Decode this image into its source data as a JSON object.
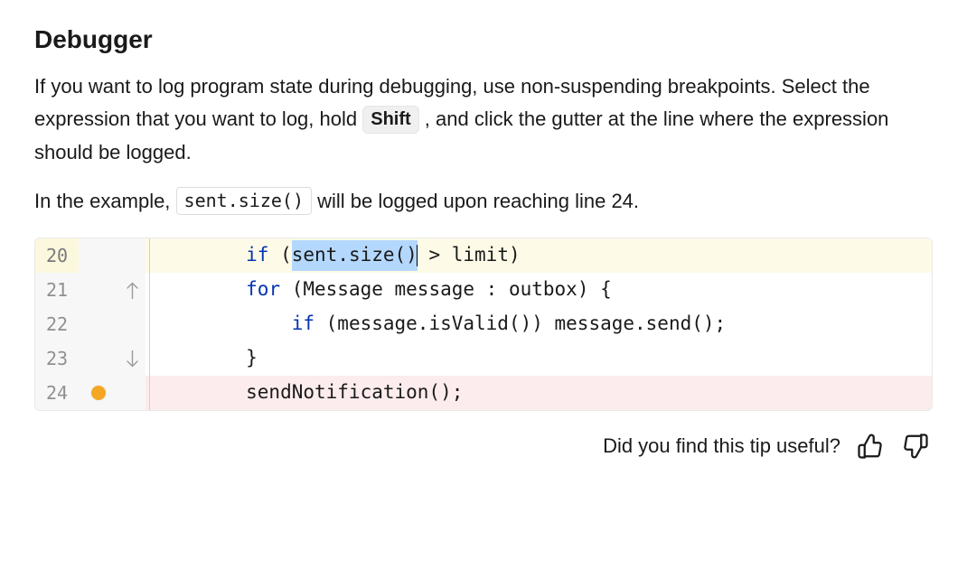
{
  "title": "Debugger",
  "para1": {
    "t0": "If you want to log program state during debugging, use non-suspending breakpoints. Select the expression that you want to log, hold ",
    "kbd": "Shift",
    "t1": " , and click the gutter at the line where the expression should be logged."
  },
  "para2": {
    "t0": "In the example, ",
    "code": "sent.size()",
    "t1": " will be logged upon reaching line 24."
  },
  "editor": {
    "rows": [
      {
        "n": "20",
        "highlight": "yellow",
        "pre_kw": "        ",
        "kw": "if",
        "before_sel": " (",
        "sel": "sent.size()",
        "after_sel": " > limit)",
        "caret": true
      },
      {
        "n": "21",
        "fold": "top",
        "pre_kw": "        ",
        "kw": "for",
        "rest": " (Message message : outbox) {"
      },
      {
        "n": "22",
        "pre_kw": "            ",
        "kw": "if",
        "rest": " (message.isValid()) message.send();"
      },
      {
        "n": "23",
        "fold": "bottom",
        "rest": "        }"
      },
      {
        "n": "24",
        "highlight": "red",
        "breakpoint": true,
        "rest": "        sendNotification();"
      }
    ]
  },
  "feedback": {
    "prompt": "Did you find this tip useful?"
  }
}
